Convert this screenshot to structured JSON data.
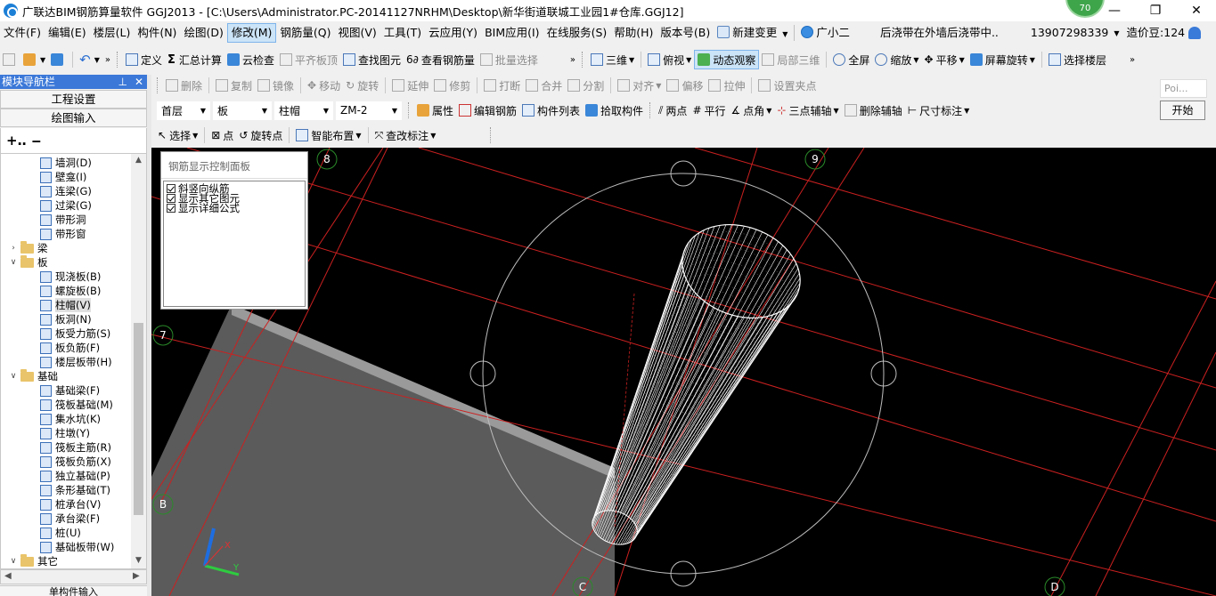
{
  "window": {
    "title": "广联达BIM钢筋算量软件 GGJ2013 - [C:\\Users\\Administrator.PC-20141127NRHM\\Desktop\\新华街道联城工业园1#仓库.GGJ12]",
    "badge": "70"
  },
  "menu": {
    "items": [
      "文件(F)",
      "编辑(E)",
      "楼层(L)",
      "构件(N)",
      "绘图(D)",
      "修改(M)",
      "钢筋量(Q)",
      "视图(V)",
      "工具(T)",
      "云应用(Y)",
      "BIM应用(I)",
      "在线服务(S)",
      "帮助(H)",
      "版本号(B)"
    ],
    "new_change": "新建变更",
    "assistant": "广小二",
    "notice": "后浇带在外墙后浇带中..",
    "phone": "13907298339",
    "cost_beans": "造价豆:124"
  },
  "toolbar1": {
    "define": "定义",
    "sum_calc": "汇总计算",
    "cloud_check": "云检查",
    "flat_slab_top": "平齐板顶",
    "find_element": "查找图元",
    "view_rebar_qty": "查看钢筋量",
    "batch_select": "批量选择",
    "threed": "三维",
    "top_view": "俯视",
    "dynamic_observe": "动态观察",
    "local_3d": "局部三维",
    "full_screen": "全屏",
    "zoom": "缩放",
    "pan": "平移",
    "screen_rotate": "屏幕旋转",
    "select_floor": "选择楼层"
  },
  "toolbar2": [
    "删除",
    "复制",
    "镜像",
    "移动",
    "旋转",
    "延伸",
    "修剪",
    "打断",
    "合并",
    "分割",
    "对齐",
    "偏移",
    "拉伸",
    "设置夹点"
  ],
  "toolbar3": {
    "floor": "首层",
    "category": "板",
    "type": "柱帽",
    "element": "ZM-2",
    "properties": "属性",
    "edit_rebar": "编辑钢筋",
    "element_list": "构件列表",
    "pick_element": "拾取构件",
    "two_points": "两点",
    "parallel": "平行",
    "point_angle": "点角",
    "three_point_axis": "三点辅轴",
    "delete_axis": "删除辅轴",
    "dimension": "尺寸标注"
  },
  "toolbar4": {
    "select": "选择",
    "point": "点",
    "rotate_point": "旋转点",
    "smart_layout": "智能布置",
    "change_label": "查改标注"
  },
  "nav": {
    "title": "模块导航栏",
    "btn_project": "工程设置",
    "btn_draw": "绘图输入",
    "btn_bottom": "单构件输入",
    "tree": [
      {
        "label": "墙洞(D)",
        "level": 2
      },
      {
        "label": "壁龛(I)",
        "level": 2
      },
      {
        "label": "连梁(G)",
        "level": 2
      },
      {
        "label": "过梁(G)",
        "level": 2
      },
      {
        "label": "带形洞",
        "level": 2
      },
      {
        "label": "带形窗",
        "level": 2
      },
      {
        "label": "梁",
        "level": 1,
        "folder": true,
        "collapsed": true
      },
      {
        "label": "板",
        "level": 1,
        "folder": true
      },
      {
        "label": "现浇板(B)",
        "level": 2
      },
      {
        "label": "螺旋板(B)",
        "level": 2
      },
      {
        "label": "柱帽(V)",
        "level": 2,
        "selected": true
      },
      {
        "label": "板洞(N)",
        "level": 2
      },
      {
        "label": "板受力筋(S)",
        "level": 2
      },
      {
        "label": "板负筋(F)",
        "level": 2
      },
      {
        "label": "楼层板带(H)",
        "level": 2
      },
      {
        "label": "基础",
        "level": 1,
        "folder": true
      },
      {
        "label": "基础梁(F)",
        "level": 2
      },
      {
        "label": "筏板基础(M)",
        "level": 2
      },
      {
        "label": "集水坑(K)",
        "level": 2
      },
      {
        "label": "柱墩(Y)",
        "level": 2
      },
      {
        "label": "筏板主筋(R)",
        "level": 2
      },
      {
        "label": "筏板负筋(X)",
        "level": 2
      },
      {
        "label": "独立基础(P)",
        "level": 2
      },
      {
        "label": "条形基础(T)",
        "level": 2
      },
      {
        "label": "桩承台(V)",
        "level": 2
      },
      {
        "label": "承台梁(F)",
        "level": 2
      },
      {
        "label": "桩(U)",
        "level": 2
      },
      {
        "label": "基础板带(W)",
        "level": 2
      },
      {
        "label": "其它",
        "level": 1,
        "folder": true
      }
    ]
  },
  "rebar_panel": {
    "title": "钢筋显示控制面板",
    "options": [
      "斜竖向纵筋",
      "显示其它图元",
      "显示详细公式"
    ]
  },
  "canvas": {
    "axis_labels": {
      "top_left": "8",
      "top_right": "9",
      "left_mid": "7",
      "left_low": "B",
      "bottom_c": "C",
      "bottom_d": "D"
    },
    "axis_triad": {
      "x": "X",
      "y": "Y"
    }
  },
  "poi": {
    "placeholder": "Poi...",
    "start": "开始"
  }
}
